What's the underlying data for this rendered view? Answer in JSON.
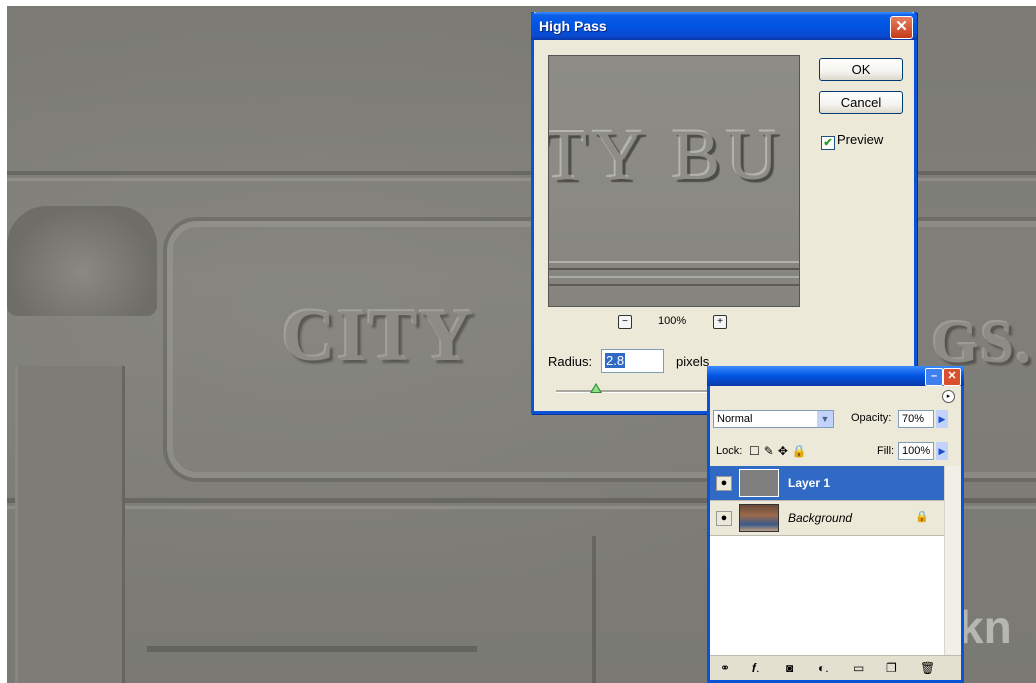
{
  "background_scene": {
    "carved_text_left": "CITY",
    "carved_text_right": "GS.",
    "watermark": "kn"
  },
  "high_pass_dialog": {
    "title": "High Pass",
    "close_glyph": "✕",
    "preview_text": "TY BU",
    "ok_label": "OK",
    "cancel_label": "Cancel",
    "preview_checkbox_label": "Preview",
    "preview_checked": true,
    "zoom_out_glyph": "−",
    "zoom_in_glyph": "+",
    "zoom_level": "100%",
    "radius_label": "Radius:",
    "radius_value": "2.8",
    "radius_unit": "pixels",
    "slider_fraction": 0.17
  },
  "layers_panel": {
    "minimize_glyph": "–",
    "close_glyph": "✕",
    "menu_glyph": "▸",
    "blend_mode": "Normal",
    "opacity_label": "Opacity:",
    "opacity_value": "70%",
    "lock_label": "Lock:",
    "lock_icons": "☐✎✥🔒",
    "fill_label": "Fill:",
    "fill_value": "100%",
    "layers": [
      {
        "name": "Layer 1",
        "selected": true,
        "visible": true
      },
      {
        "name": "Background",
        "selected": false,
        "visible": true,
        "locked": true
      }
    ],
    "bottom_icons": [
      "link-icon",
      "style-icon",
      "mask-icon",
      "adjustment-icon",
      "group-icon",
      "new-layer-icon",
      "delete-icon"
    ]
  },
  "colors": {
    "title_bar_blue": "#0054e3",
    "selection_blue": "#316ac5",
    "dialog_face": "#ece9d8"
  }
}
